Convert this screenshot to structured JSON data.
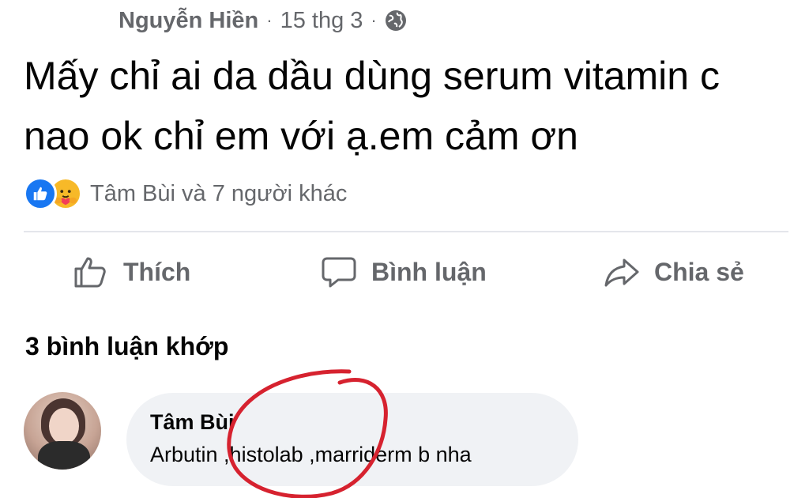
{
  "post": {
    "author": "Nguyễn Hiền",
    "separator": "·",
    "date": "15 thg 3",
    "audience_icon": "globe-icon",
    "text": "Mấy chỉ ai da dầu dùng serum vitamin c nao ok chỉ em với ạ.em cảm ơn"
  },
  "reactions": {
    "icons": [
      "like-reaction-icon",
      "care-reaction-icon"
    ],
    "summary": "Tâm Bùi và 7 người khác"
  },
  "actions": [
    {
      "label": "Thích",
      "icon": "thumbs-up-icon"
    },
    {
      "label": "Bình luận",
      "icon": "comment-icon"
    },
    {
      "label": "Chia sẻ",
      "icon": "share-icon"
    }
  ],
  "comments": {
    "heading": "3 bình luận khớp",
    "items": [
      {
        "author": "Tâm Bùi",
        "text": "Arbutin ,histolab ,marriderm b nha"
      }
    ]
  },
  "colors": {
    "text": "#050505",
    "secondary_text": "#65676b",
    "like_blue": "#1877f2",
    "care_yellow": "#f7b928",
    "bubble_bg": "#f0f2f5",
    "annotation_red": "#d6222f"
  }
}
